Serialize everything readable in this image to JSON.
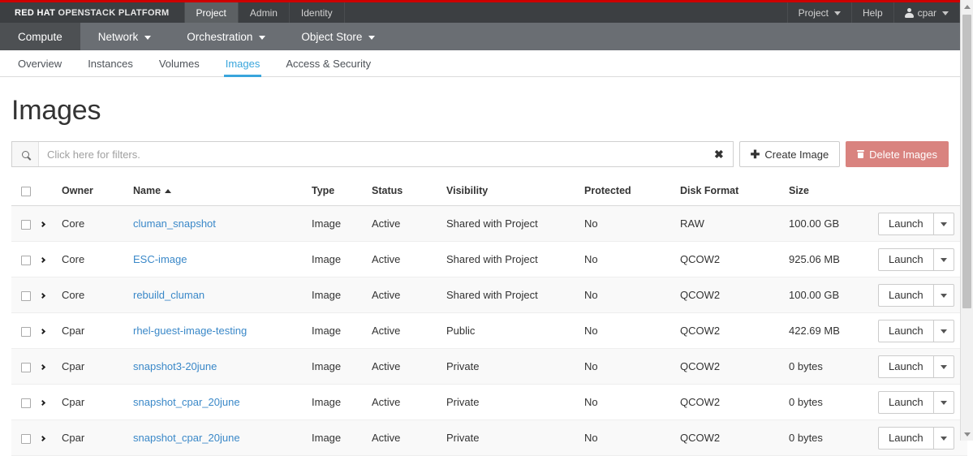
{
  "masthead": {
    "brand_rh": "RED HAT",
    "brand_osp": "OPENSTACK PLATFORM",
    "tabs": [
      {
        "label": "Project",
        "active": true
      },
      {
        "label": "Admin",
        "active": false
      },
      {
        "label": "Identity",
        "active": false
      }
    ],
    "right": {
      "project_label": "Project",
      "help_label": "Help",
      "user_label": "cpar",
      "user_icon": "user-icon",
      "caret_icon": "chevron-down-icon"
    }
  },
  "subnav": {
    "items": [
      {
        "label": "Compute",
        "active": true,
        "has_caret": false
      },
      {
        "label": "Network",
        "active": false,
        "has_caret": true
      },
      {
        "label": "Orchestration",
        "active": false,
        "has_caret": true
      },
      {
        "label": "Object Store",
        "active": false,
        "has_caret": true
      }
    ]
  },
  "tabstrip": {
    "tabs": [
      {
        "label": "Overview",
        "active": false
      },
      {
        "label": "Instances",
        "active": false
      },
      {
        "label": "Volumes",
        "active": false
      },
      {
        "label": "Images",
        "active": true
      },
      {
        "label": "Access & Security",
        "active": false
      }
    ],
    "active_color": "#39a5dc"
  },
  "page": {
    "title": "Images"
  },
  "toolbar": {
    "search_icon": "search-icon",
    "search_value": "",
    "search_placeholder": "Click here for filters.",
    "clear_icon": "✖",
    "create_label": "Create Image",
    "create_icon": "plus-icon",
    "delete_label": "Delete Images",
    "delete_icon": "trash-icon",
    "delete_color": "#d9837f"
  },
  "table": {
    "sort_column": "Name",
    "sort_direction": "asc",
    "headers": {
      "select_all": "",
      "expand": "",
      "owner": "Owner",
      "name": "Name",
      "type": "Type",
      "status": "Status",
      "visibility": "Visibility",
      "protected": "Protected",
      "disk_format": "Disk Format",
      "size": "Size",
      "actions": ""
    },
    "row_action": {
      "launch_label": "Launch",
      "caret_icon": "chevron-down-icon"
    },
    "rows": [
      {
        "owner": "Core",
        "name": "cluman_snapshot",
        "type": "Image",
        "status": "Active",
        "visibility": "Shared with Project",
        "protected": "No",
        "disk_format": "RAW",
        "size": "100.00 GB"
      },
      {
        "owner": "Core",
        "name": "ESC-image",
        "type": "Image",
        "status": "Active",
        "visibility": "Shared with Project",
        "protected": "No",
        "disk_format": "QCOW2",
        "size": "925.06 MB"
      },
      {
        "owner": "Core",
        "name": "rebuild_cluman",
        "type": "Image",
        "status": "Active",
        "visibility": "Shared with Project",
        "protected": "No",
        "disk_format": "QCOW2",
        "size": "100.00 GB"
      },
      {
        "owner": "Cpar",
        "name": "rhel-guest-image-testing",
        "type": "Image",
        "status": "Active",
        "visibility": "Public",
        "protected": "No",
        "disk_format": "QCOW2",
        "size": "422.69 MB"
      },
      {
        "owner": "Cpar",
        "name": "snapshot3-20june",
        "type": "Image",
        "status": "Active",
        "visibility": "Private",
        "protected": "No",
        "disk_format": "QCOW2",
        "size": "0 bytes"
      },
      {
        "owner": "Cpar",
        "name": "snapshot_cpar_20june",
        "type": "Image",
        "status": "Active",
        "visibility": "Private",
        "protected": "No",
        "disk_format": "QCOW2",
        "size": "0 bytes"
      },
      {
        "owner": "Cpar",
        "name": "snapshot_cpar_20june",
        "type": "Image",
        "status": "Active",
        "visibility": "Private",
        "protected": "No",
        "disk_format": "QCOW2",
        "size": "0 bytes"
      }
    ]
  },
  "scrollbar": {
    "up_icon": "scroll-up-arrow-icon",
    "down_icon": "scroll-down-arrow-icon"
  }
}
